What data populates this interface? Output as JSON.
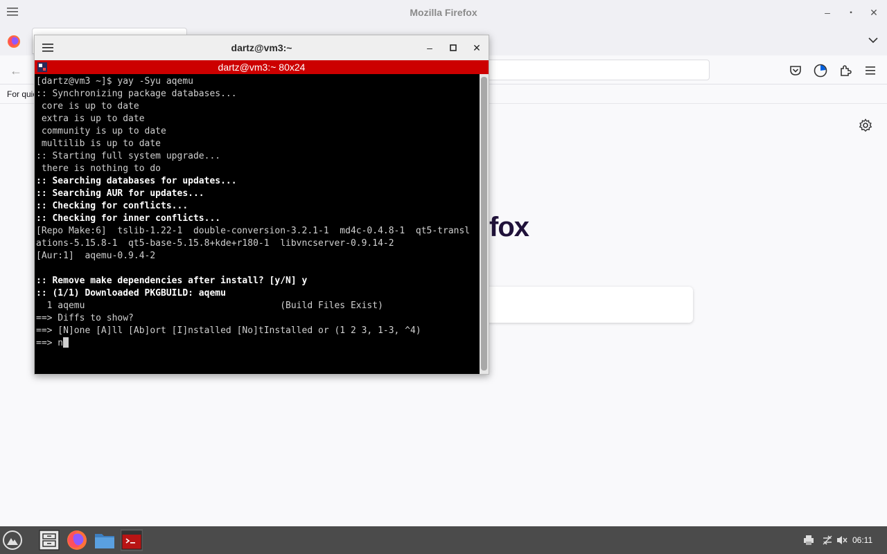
{
  "firefox": {
    "window_title": "Mozilla Firefox",
    "bookmarks_text": "For quic",
    "brand_fragment": "fox",
    "controls": {
      "minimize": "–",
      "maximize": "▪",
      "close": "✕"
    }
  },
  "terminal": {
    "window_title": "dartz@vm3:~",
    "tab_title": "dartz@vm3:~ 80x24",
    "controls": {
      "minimize": "–",
      "maximize": "▫",
      "close": "✕"
    },
    "lines": [
      {
        "text": "[dartz@vm3 ~]$ yay -Syu aqemu",
        "bold": false
      },
      {
        "text": ":: Synchronizing package databases...",
        "bold": false
      },
      {
        "text": " core is up to date",
        "bold": false
      },
      {
        "text": " extra is up to date",
        "bold": false
      },
      {
        "text": " community is up to date",
        "bold": false
      },
      {
        "text": " multilib is up to date",
        "bold": false
      },
      {
        "text": ":: Starting full system upgrade...",
        "bold": false
      },
      {
        "text": " there is nothing to do",
        "bold": false
      },
      {
        "text": ":: Searching databases for updates...",
        "bold": true
      },
      {
        "text": ":: Searching AUR for updates...",
        "bold": true
      },
      {
        "text": ":: Checking for conflicts...",
        "bold": true
      },
      {
        "text": ":: Checking for inner conflicts...",
        "bold": true
      },
      {
        "text": "[Repo Make:6]  tslib-1.22-1  double-conversion-3.2.1-1  md4c-0.4.8-1  qt5-transl",
        "bold": false
      },
      {
        "text": "ations-5.15.8-1  qt5-base-5.15.8+kde+r180-1  libvncserver-0.9.14-2",
        "bold": false
      },
      {
        "text": "[Aur:1]  aqemu-0.9.4-2",
        "bold": false
      },
      {
        "text": "",
        "bold": false
      },
      {
        "text": ":: Remove make dependencies after install? [y/N] y",
        "bold": true
      },
      {
        "text": ":: (1/1) Downloaded PKGBUILD: aqemu",
        "bold": true
      },
      {
        "text": "  1 aqemu                                    (Build Files Exist)",
        "bold": false
      },
      {
        "text": "==> Diffs to show?",
        "bold": false
      },
      {
        "text": "==> [N]one [A]ll [Ab]ort [I]nstalled [No]tInstalled or (1 2 3, 1-3, ^4)",
        "bold": false
      },
      {
        "text": "==> n",
        "bold": false,
        "cursor": true
      }
    ]
  },
  "taskbar": {
    "clock": "06:11",
    "apps": [
      "start-menu-icon",
      "file-manager-icon",
      "firefox-icon",
      "folder-icon",
      "terminal-icon"
    ]
  },
  "colors": {
    "terminal_tab_accent": "#cc0000",
    "terminal_bg": "#000000",
    "taskbar_bg": "#4b4b4b"
  }
}
